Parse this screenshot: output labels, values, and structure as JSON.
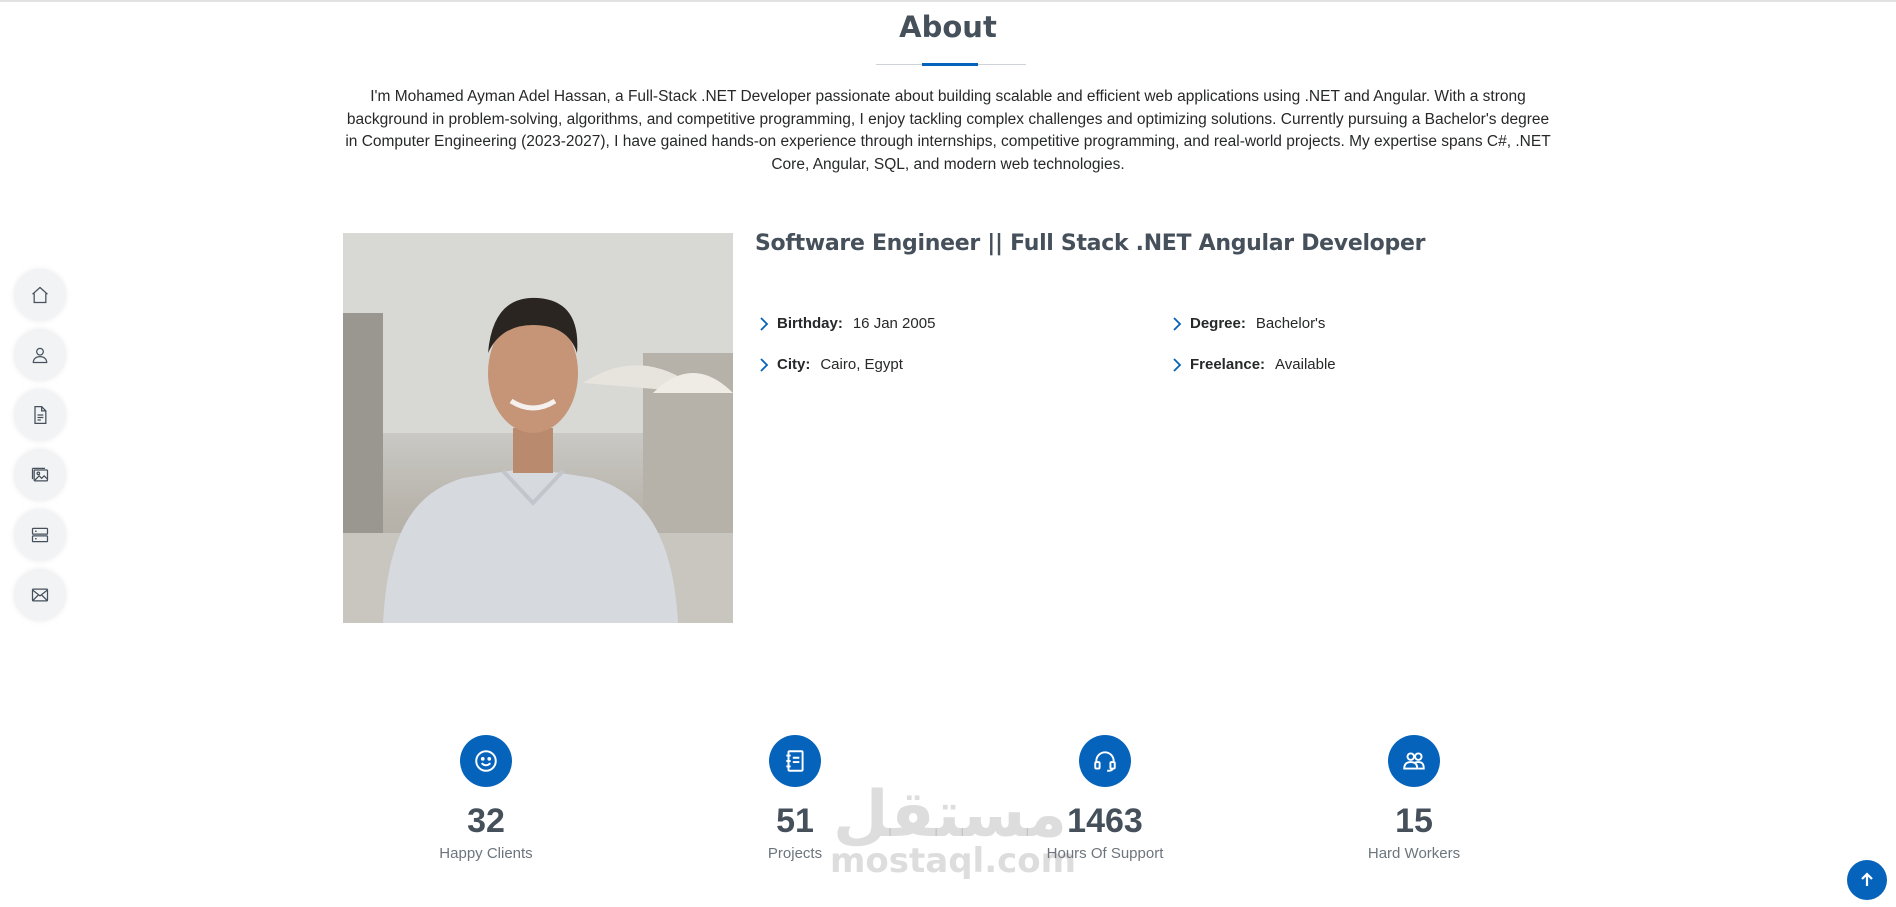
{
  "section": {
    "title": "About",
    "intro": "I'm Mohamed Ayman Adel Hassan, a Full-Stack .NET Developer passionate about building scalable and efficient web applications using .NET and Angular. With a strong background in problem-solving, algorithms, and competitive programming, I enjoy tackling complex challenges and optimizing solutions. Currently pursuing a Bachelor's degree in Computer Engineering (2023-2027), I have gained hands-on experience through internships, competitive programming, and real-world projects. My expertise spans C#, .NET Core, Angular, SQL, and modern web technologies."
  },
  "profile": {
    "role": "Software Engineer || Full Stack .NET Angular Developer",
    "info": [
      {
        "label": "Birthday:",
        "value": "16 Jan 2005"
      },
      {
        "label": "Degree:",
        "value": "Bachelor's"
      },
      {
        "label": "City:",
        "value": "Cairo, Egypt"
      },
      {
        "label": "Freelance:",
        "value": "Available"
      }
    ]
  },
  "nav": [
    {
      "icon": "home-icon"
    },
    {
      "icon": "person-icon"
    },
    {
      "icon": "file-icon"
    },
    {
      "icon": "images-icon"
    },
    {
      "icon": "server-icon"
    },
    {
      "icon": "envelope-icon"
    }
  ],
  "stats": [
    {
      "icon": "smiley-icon",
      "number": "32",
      "label": "Happy Clients"
    },
    {
      "icon": "journal-icon",
      "number": "51",
      "label": "Projects"
    },
    {
      "icon": "headset-icon",
      "number": "1463",
      "label": "Hours Of Support"
    },
    {
      "icon": "people-icon",
      "number": "15",
      "label": "Hard Workers"
    }
  ],
  "watermark": {
    "arabic": "مستقل",
    "latin": "mostaql.com"
  },
  "colors": {
    "accent": "#0563bb",
    "heading": "#45505b",
    "text": "#272829",
    "muted": "#6c757d"
  }
}
